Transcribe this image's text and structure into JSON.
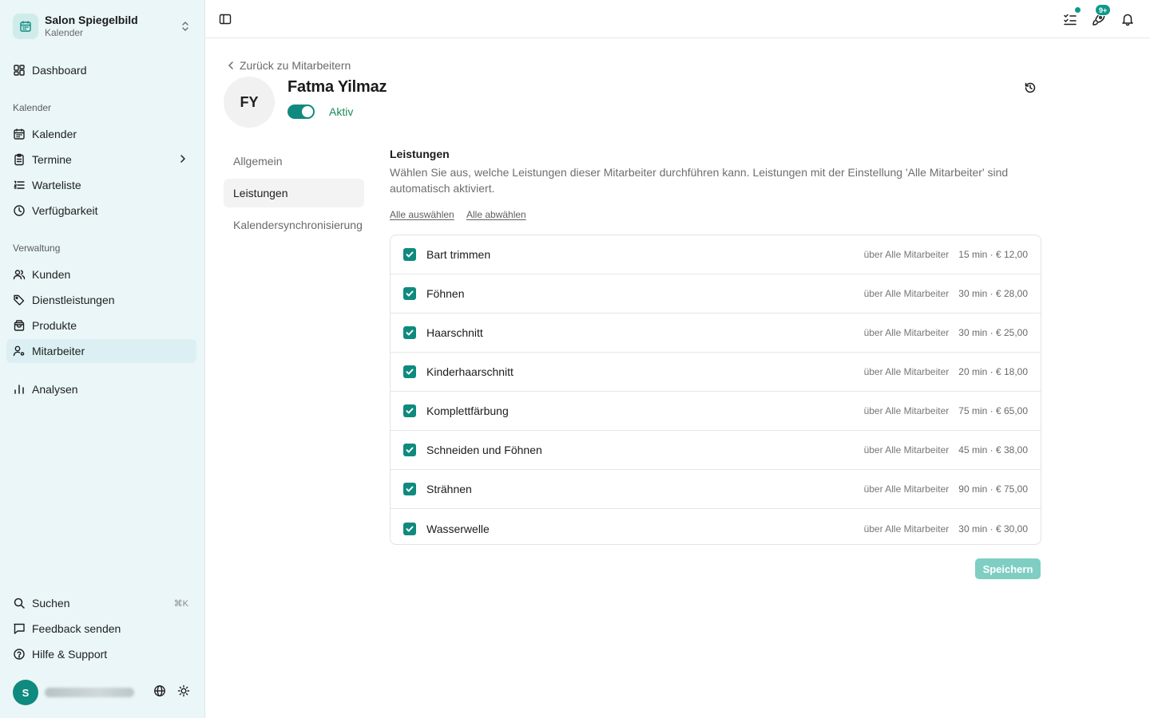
{
  "org": {
    "name": "Salon Spiegelbild",
    "subtitle": "Kalender"
  },
  "sidebar": {
    "dashboard": "Dashboard",
    "section_calendar": "Kalender",
    "calendar_items": [
      "Kalender",
      "Termine",
      "Warteliste",
      "Verfügbarkeit"
    ],
    "section_admin": "Verwaltung",
    "admin_items": [
      "Kunden",
      "Dienstleistungen",
      "Produkte",
      "Mitarbeiter"
    ],
    "analytics": "Analysen",
    "search": "Suchen",
    "search_shortcut": "⌘K",
    "feedback": "Feedback senden",
    "help": "Hilfe & Support",
    "user_initial": "S"
  },
  "topbar": {
    "notifications_badge": "9+"
  },
  "employee": {
    "back_label": "Zurück zu Mitarbeitern",
    "initials": "FY",
    "name": "Fatma Yilmaz",
    "status": "Aktiv"
  },
  "subnav": [
    "Allgemein",
    "Leistungen",
    "Kalendersynchronisierung"
  ],
  "services_section": {
    "title": "Leistungen",
    "description": "Wählen Sie aus, welche Leistungen dieser Mitarbeiter durchführen kann. Leistungen mit der Einstellung 'Alle Mitarbeiter' sind automatisch aktiviert.",
    "select_all": "Alle auswählen",
    "deselect_all": "Alle abwählen",
    "items": [
      {
        "name": "Bart trimmen",
        "source": "über Alle Mitarbeiter",
        "meta": "15 min · € 12,00",
        "checked": true
      },
      {
        "name": "Föhnen",
        "source": "über Alle Mitarbeiter",
        "meta": "30 min · € 28,00",
        "checked": true
      },
      {
        "name": "Haarschnitt",
        "source": "über Alle Mitarbeiter",
        "meta": "30 min · € 25,00",
        "checked": true
      },
      {
        "name": "Kinderhaarschnitt",
        "source": "über Alle Mitarbeiter",
        "meta": "20 min · € 18,00",
        "checked": true
      },
      {
        "name": "Komplettfärbung",
        "source": "über Alle Mitarbeiter",
        "meta": "75 min · € 65,00",
        "checked": true
      },
      {
        "name": "Schneiden und Föhnen",
        "source": "über Alle Mitarbeiter",
        "meta": "45 min · € 38,00",
        "checked": true
      },
      {
        "name": "Strähnen",
        "source": "über Alle Mitarbeiter",
        "meta": "90 min · € 75,00",
        "checked": true
      },
      {
        "name": "Wasserwelle",
        "source": "über Alle Mitarbeiter",
        "meta": "30 min · € 30,00",
        "checked": true
      }
    ],
    "save_label": "Speichern"
  },
  "colors": {
    "accent": "#0f8a7e",
    "sidebar_bg": "#eaf6f8",
    "active_status": "#1a8a5a"
  }
}
